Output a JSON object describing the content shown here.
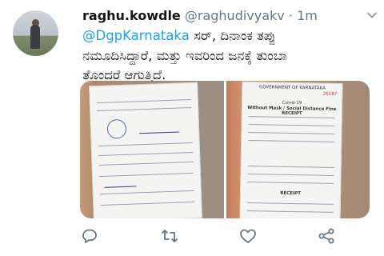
{
  "tweet": {
    "display_name": "raghu.kowdle",
    "handle": "@raghudivyakv",
    "separator": "·",
    "time": "1m",
    "mention": "@DgpKarnataka",
    "text_line1_rest": " ಸರ್, ದಿನಾಂಕ ತಪ್ಪು",
    "text_line2": "ನಮೂದಿಸಿದ್ದಾರೆ, ಮತ್ತು ಇವರಿಂದ ಜನಕ್ಕೆ ತುಂಬಾ",
    "text_line3": "ತೊಂದರೆ ಆಗುತ್ತಿದೆ."
  },
  "photo_right_text": {
    "gov": "GOVERNMENT OF KARNATAKA",
    "number": "26187",
    "covid": "Covid-19",
    "receipt": "Without Mask / Social Distance Fine RECEIPT",
    "receipt_label": "RECEIPT"
  },
  "icons": [
    "caret-down-icon",
    "reply-icon",
    "retweet-icon",
    "like-icon",
    "share-icon"
  ],
  "colors": {
    "accent": "#1da1f2",
    "text": "#14171a",
    "muted": "#657786"
  }
}
